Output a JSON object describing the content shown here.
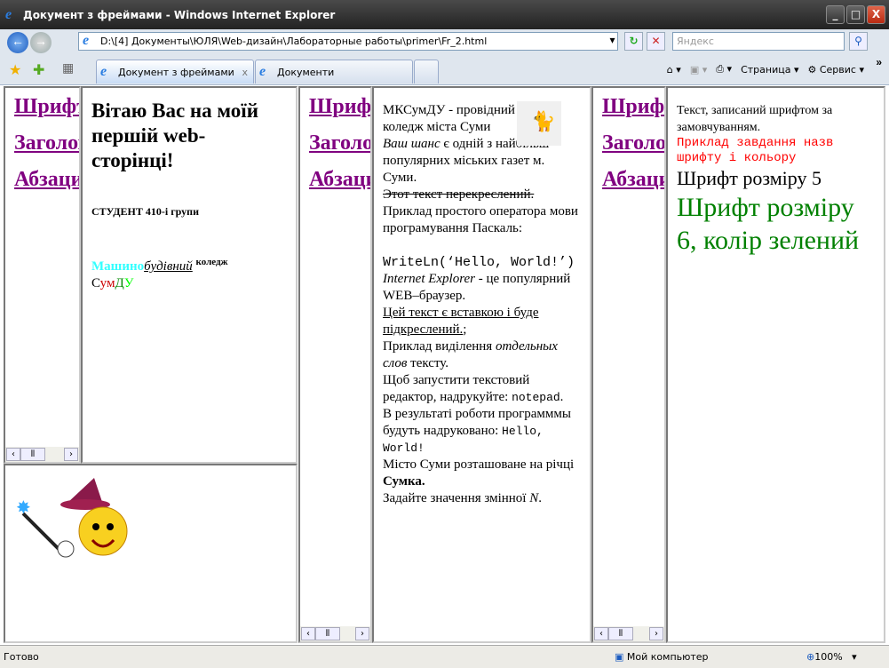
{
  "window": {
    "title": "Документ з фреймами - Windows Internet Explorer",
    "minimize": "_",
    "maximize": "□",
    "close": "X"
  },
  "nav": {
    "back": "←",
    "forward": "→",
    "address": "D:\\[4] Документы\\ЮЛЯ\\Web-дизайн\\Лабораторные работы\\primer\\Fr_2.html",
    "search_placeholder": "Яндекс",
    "refresh": "↻",
    "stop": "✕",
    "search_btn": "⚲"
  },
  "tabs": [
    {
      "label": "Документ з фреймами",
      "close": "x"
    },
    {
      "label": "Документи"
    }
  ],
  "toolbar": {
    "page": "Страница",
    "service": "Сервис",
    "more": "»"
  },
  "links": [
    "Шрифти",
    "Заголовки",
    "Абзаци"
  ],
  "frame_b": {
    "heading": "Вітаю Вас на моїй першій web-сторінці!",
    "student": "СТУДЕНТ 410-і групи",
    "w1": "Машино",
    "w2": "будівний",
    "w3": "коледж",
    "c1": "С",
    "c2": "ум",
    "c3": "Д",
    "c4": "У"
  },
  "frame_e": {
    "intro": "МКСумДУ - провідний коледж міста Суми",
    "chance": "Ваш шанс",
    "chance_rest": " є одній з найбільш популярних міських газет м. Суми.",
    "strike": "Этот текст перекреслений.",
    "pascal": "Приклад простого оператора мови програмування Паскаль:",
    "code": "WriteLn(‘Hello, World!’)",
    "ie": "Internet Explorer",
    "ie_rest": " - це популярний WEB–браузер.",
    "ins": "Цей текст є вставкою і буде підкреслений.",
    "ins_rest": ";",
    "sel1": "Приклад виділення ",
    "sel_em": "отдельных слов",
    "sel2": " тексту.",
    "run": "Щоб запустити текстовий редактор, надрукуйте: ",
    "notepad": "notepad",
    "notepad_end": ".",
    "result": "В результаті роботи программмы будуть надруковано: ",
    "hello": "Hello, World!",
    "city": "Місто Суми розташоване на річці ",
    "river": "Сумка.",
    "var": "Задайте значення змінної ",
    "n": "N",
    "var_end": "."
  },
  "frame_g": {
    "default": "Текст, записаний шрифтом за замовчуванням.",
    "red": "Приклад завдання назв шрифту і кольору",
    "size5": "Шрифт розміру 5",
    "size6": "Шрифт розміру 6, колір зелений"
  },
  "status": {
    "text": "Готово",
    "zone": "Мой компьютер",
    "zoom": "100%"
  },
  "colors": {
    "link": "#800080",
    "cyan": "#33ffff",
    "red": "#ff0000",
    "green": "#008000",
    "lime": "#00ff00"
  }
}
